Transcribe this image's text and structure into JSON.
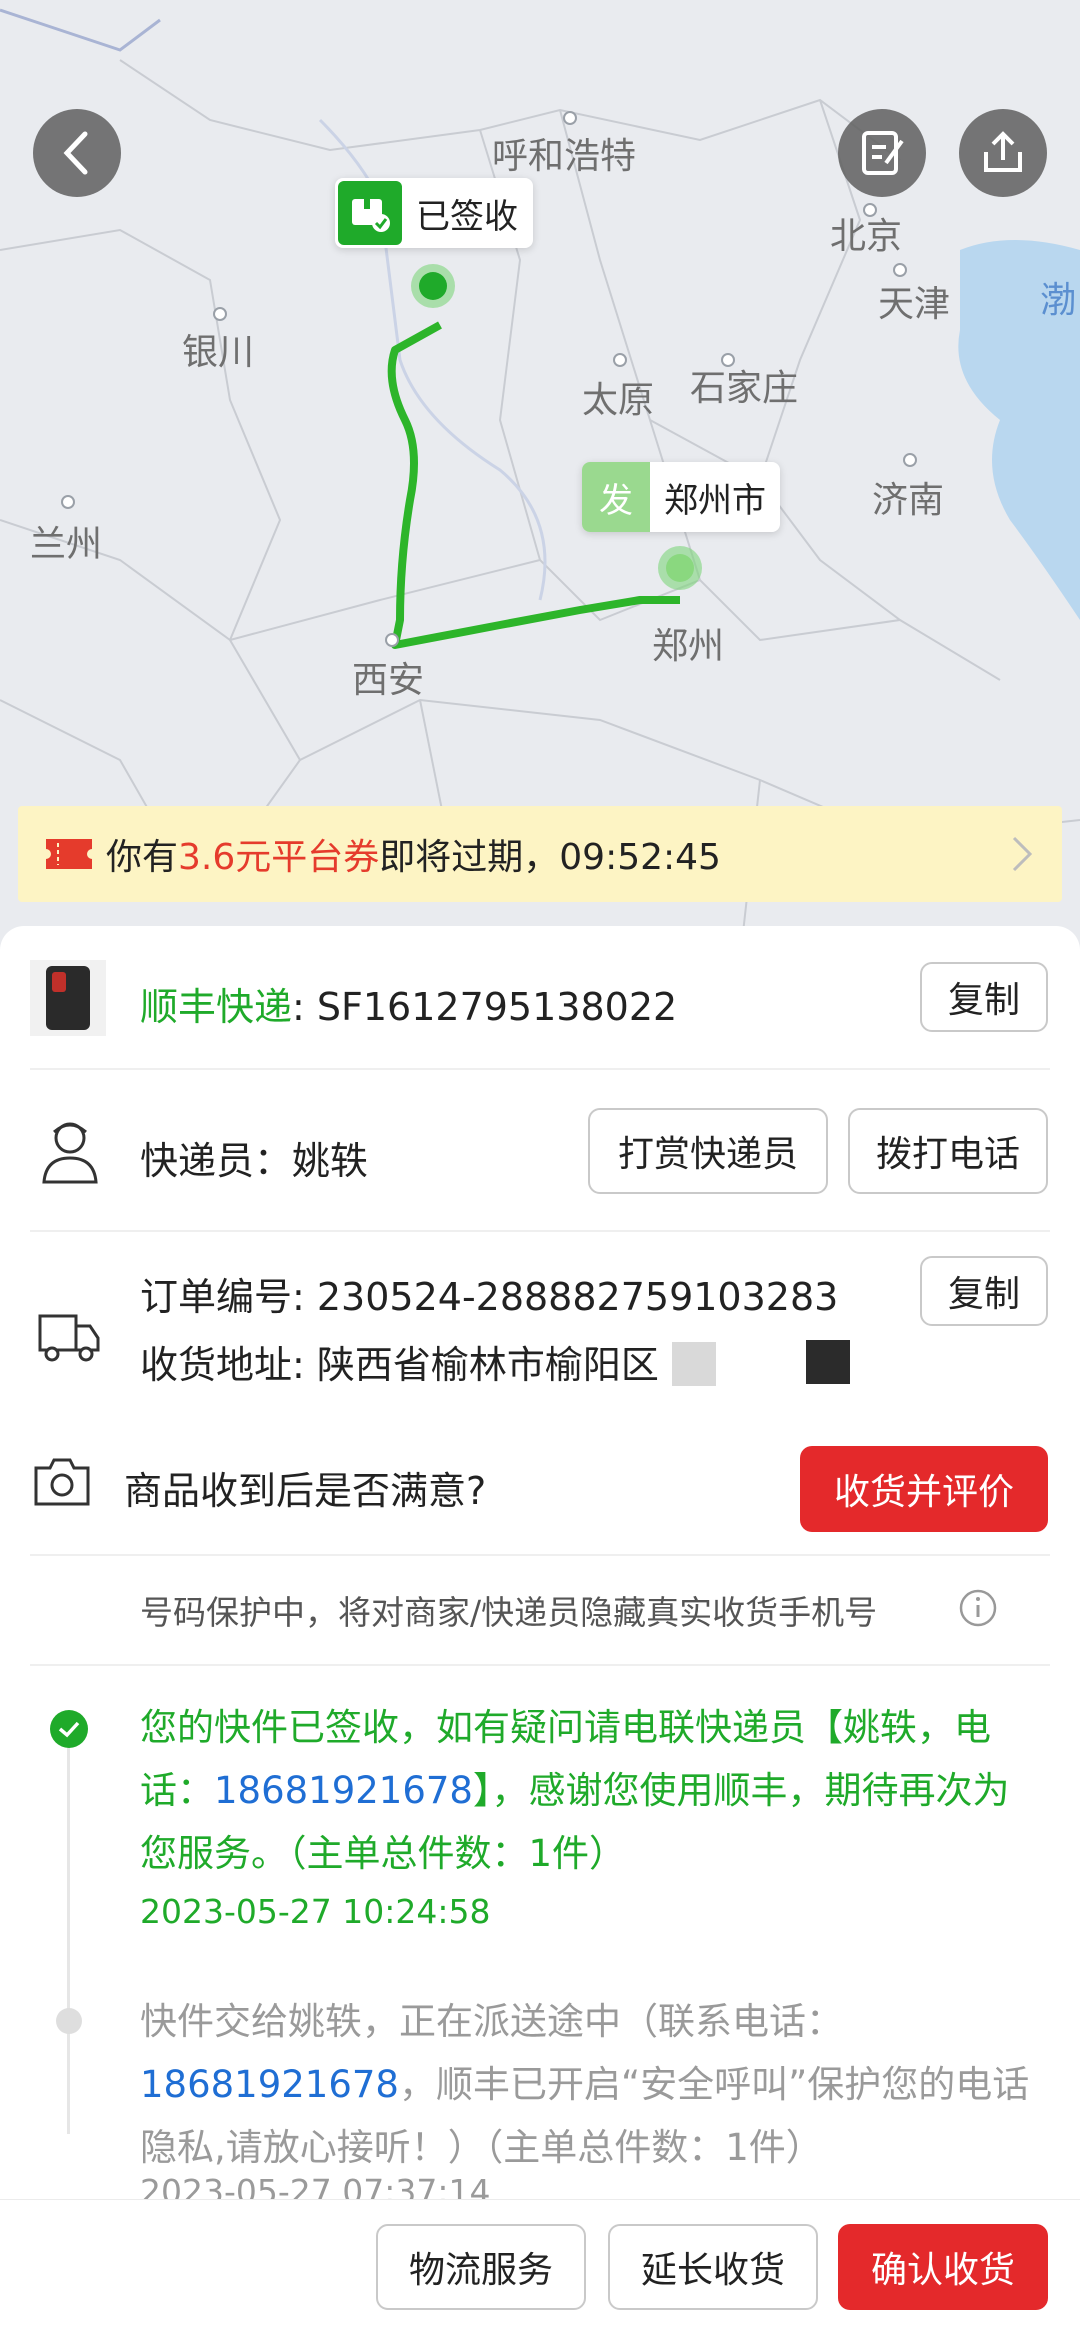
{
  "map": {
    "cities": [
      "呼和浩特",
      "北京",
      "天津",
      "银川",
      "太原",
      "石家庄",
      "兰州",
      "济南",
      "西安",
      "郑州",
      "渤"
    ],
    "delivered_marker": "已签收",
    "origin_tag": "发",
    "origin_city": "郑州市"
  },
  "top_actions": {
    "back_icon": "chevron-left-icon",
    "edit_icon": "edit-note-icon",
    "share_icon": "share-icon"
  },
  "coupon": {
    "prefix": "你有",
    "highlight": "3.6元平台券",
    "suffix": "即将过期，09:52:45"
  },
  "shipment": {
    "carrier": "顺丰快递",
    "tracking_number": ": SF1612795138022",
    "copy_label": "复制"
  },
  "courier": {
    "label": "快递员：",
    "name": "姚轶",
    "tip_button": "打赏快递员",
    "call_button": "拨打电话"
  },
  "order": {
    "order_label": "订单编号: 230524-288882759103283",
    "copy_label": "复制",
    "address_label": "收货地址: 陕西省榆林市榆阳区"
  },
  "feedback": {
    "question": "商品收到后是否满意?",
    "button": "收货并评价"
  },
  "privacy_note": "号码保护中，将对商家/快递员隐藏真实收货手机号",
  "timeline": [
    {
      "text_a": "您的快件已签收，如有疑问请电联快递员【姚轶，电话：",
      "phone": "18681921678",
      "text_b": "】，感谢您使用顺丰，期待再次为您服务。（主单总件数：1件）",
      "time": "2023-05-27 10:24:58",
      "status": "done"
    },
    {
      "text_a": "快件交给姚轶，正在派送途中（联系电话：",
      "phone": "18681921678",
      "text_b": "，顺丰已开启“安全呼叫”保护您的电话隐私,请放心接听！）（主单总件数：1件）",
      "time": "2023-05-27 07:37:14",
      "status": "pending"
    }
  ],
  "bottom_bar": {
    "logistics": "物流服务",
    "extend": "延长收货",
    "confirm": "确认收货"
  },
  "colors": {
    "brand_green": "#1faa2a",
    "link_blue": "#1f6ed4",
    "accent_red": "#e4292b",
    "coupon_bg": "#fdf4c4"
  }
}
